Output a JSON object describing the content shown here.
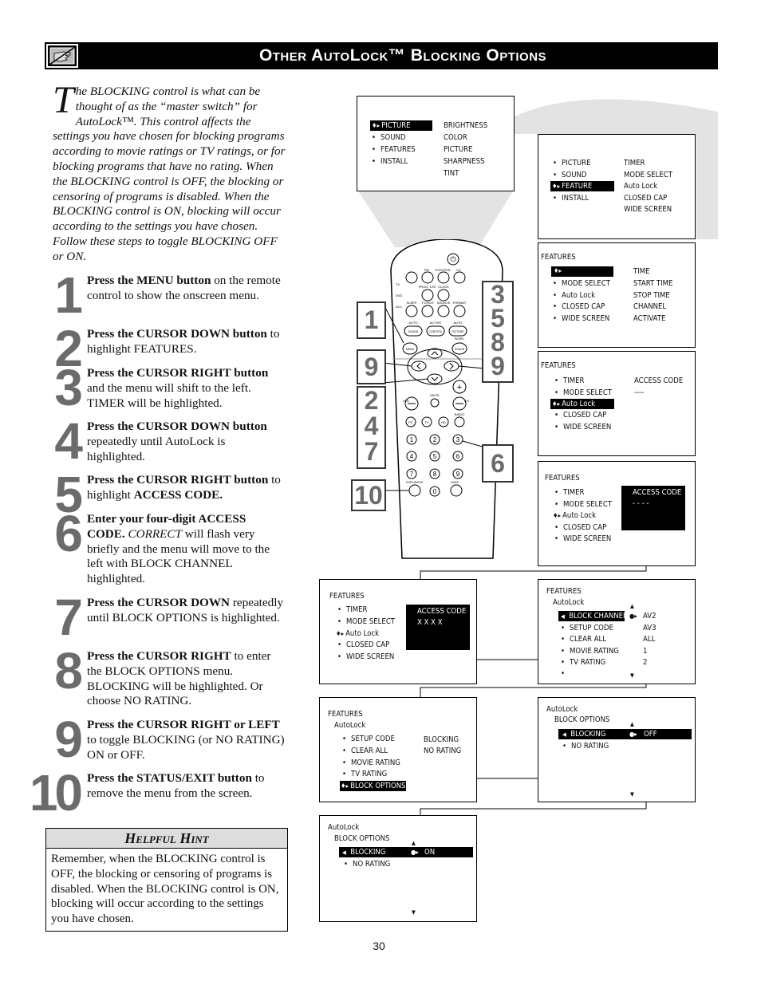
{
  "header": {
    "title": "Other AutoLock™ Blocking Options",
    "icon": "pointing-hand-icon"
  },
  "intro": {
    "dropcap": "T",
    "text": "he BLOCKING control is what can be thought of as the “master switch” for AutoLock™. This control affects the settings you have chosen for blocking programs according to movie ratings or TV ratings, or for blocking programs that have no rating. When the BLOCKING control is OFF, the blocking or censoring of programs is disabled. When the BLOCKING control is ON, blocking will occur according to the settings you have chosen. Follow these steps to toggle BLOCKING OFF or ON."
  },
  "steps": [
    {
      "num": "1",
      "bold": "Press the MENU button",
      "rest": " on the remote control to show the onscreen menu."
    },
    {
      "num": "2",
      "bold": "Press the CURSOR DOWN button",
      "rest": " to highlight FEATURES."
    },
    {
      "num": "3",
      "bold": "Press the CURSOR RIGHT button",
      "rest": " and the menu will shift to the left. TIMER will be highlighted."
    },
    {
      "num": "4",
      "bold": "Press the CURSOR DOWN button",
      "rest": " repeatedly until AutoLock is highlighted."
    },
    {
      "num": "5",
      "bold": "Press the CURSOR RIGHT button",
      "rest": " to highlight ",
      "bold2": "ACCESS CODE."
    },
    {
      "num": "6",
      "bold": "Enter your four-digit ACCESS CODE.",
      "italic": " CORRECT",
      "rest": " will flash very briefly and the menu will move to the left with BLOCK CHANNEL highlighted."
    },
    {
      "num": "7",
      "bold": "Press the CURSOR DOWN",
      "rest": " repeatedly until BLOCK OPTIONS is highlighted."
    },
    {
      "num": "8",
      "bold": "Press the CURSOR RIGHT",
      "rest": " to enter the BLOCK OPTIONS menu. BLOCKING will be highlighted. Or choose NO RATING."
    },
    {
      "num": "9",
      "bold": "Press the CURSOR RIGHT or LEFT",
      "rest": " to toggle BLOCKING (or NO RATING) ON or OFF."
    },
    {
      "num": "10",
      "bold": "Press the STATUS/EXIT button",
      "rest": " to remove the menu from the screen."
    }
  ],
  "hint": {
    "title": "Helpful Hint",
    "body": "Remember, when the BLOCKING control is OFF, the blocking or censoring of programs is disabled. When the BLOCKING control is ON, blocking will occur according to the settings you have chosen."
  },
  "page_number": "30",
  "remote": {
    "labels": {
      "pip": "PIP",
      "position": "POSITION",
      "cc": "CC",
      "tv": "TV",
      "dvd": "DVD",
      "acc": "ACC",
      "prog_list": "PROG. LIST",
      "clock": "CLOCK",
      "sleep": "SLEEP",
      "tv_rch": "TV/RCH",
      "source": "SOURCE",
      "format": "FORMAT",
      "auto1": "AUTO",
      "active": "ACTIVE",
      "auto2": "AUTO",
      "sound": "SOUND",
      "control": "CONTROL",
      "picture": "PICTURE",
      "menu": "MENU",
      "surr": "SURR.",
      "surr_sound": "SOUND",
      "vol": "VOL",
      "mute": "MUTE",
      "ch": "CH",
      "pc": "PC",
      "tvbtn": "TV",
      "hd": "HD",
      "radio": "RADIO",
      "status_exit": "STATUS/EXIT",
      "surf": "SURF",
      "digits": [
        "1",
        "2",
        "3",
        "4",
        "5",
        "6",
        "7",
        "8",
        "9",
        "0"
      ]
    },
    "callouts": {
      "c1": "1",
      "c9": "9",
      "c247": [
        "2",
        "4",
        "7"
      ],
      "c10": "10",
      "c3589": [
        "3",
        "5",
        "8",
        "9"
      ],
      "c6": "6"
    }
  },
  "screens": {
    "s1": {
      "left": [
        {
          "label": "PICTURE",
          "selected": true
        },
        {
          "label": "SOUND"
        },
        {
          "label": "FEATURES"
        },
        {
          "label": "INSTALL"
        }
      ],
      "right": [
        "BRIGHTNESS",
        "COLOR",
        "PICTURE",
        "SHARPNESS",
        "TINT"
      ]
    },
    "s2": {
      "left": [
        {
          "label": "PICTURE"
        },
        {
          "label": "SOUND"
        },
        {
          "label": "FEATURE",
          "selected": true
        },
        {
          "label": "INSTALL"
        }
      ],
      "right": [
        "TIMER",
        "MODE SELECT",
        "Auto Lock",
        "CLOSED CAP",
        "WIDE SCREEN"
      ]
    },
    "s3": {
      "title": "FEATURES",
      "left": [
        {
          "label": "",
          "selected": true
        },
        {
          "label": "MODE SELECT"
        },
        {
          "label": "Auto Lock"
        },
        {
          "label": "CLOSED CAP"
        },
        {
          "label": "WIDE SCREEN"
        }
      ],
      "right": [
        "TIME",
        "START TIME",
        "STOP TIME",
        "CHANNEL",
        "ACTIVATE"
      ]
    },
    "s4": {
      "title": "FEATURES",
      "left": [
        {
          "label": "TIMER"
        },
        {
          "label": "MODE SELECT"
        },
        {
          "label": "Auto Lock",
          "selected": true
        },
        {
          "label": "CLOSED CAP"
        },
        {
          "label": "WIDE SCREEN"
        }
      ],
      "right": [
        "ACCESS CODE",
        "----"
      ]
    },
    "s5": {
      "title": "FEATURES",
      "left": [
        {
          "label": "TIMER"
        },
        {
          "label": "MODE SELECT"
        },
        {
          "label": "Auto Lock",
          "selected": true
        },
        {
          "label": "CLOSED CAP"
        },
        {
          "label": "WIDE SCREEN"
        }
      ],
      "right": [
        "ACCESS CODE",
        "- - - -"
      ]
    },
    "s6": {
      "title": "FEATURES",
      "left": [
        {
          "label": "TIMER"
        },
        {
          "label": "MODE SELECT"
        },
        {
          "label": "Auto Lock",
          "selected": true
        },
        {
          "label": "CLOSED CAP"
        },
        {
          "label": "WIDE SCREEN"
        }
      ],
      "right": [
        "ACCESS CODE",
        "X X X X"
      ]
    },
    "s7": {
      "title": "FEATURES",
      "subtitle": "AutoLock",
      "left": [
        {
          "label": "BLOCK CHANNEL",
          "selected": true
        },
        {
          "label": "SETUP CODE"
        },
        {
          "label": "CLEAR ALL"
        },
        {
          "label": "MOVIE RATING"
        },
        {
          "label": "TV RATING"
        },
        {
          "label": ""
        }
      ],
      "right": [
        "AV2",
        "AV3",
        "ALL",
        "1",
        "2"
      ]
    },
    "s8": {
      "title": "FEATURES",
      "subtitle": "AutoLock",
      "left": [
        {
          "label": "SETUP CODE"
        },
        {
          "label": "CLEAR ALL"
        },
        {
          "label": "MOVIE RATING"
        },
        {
          "label": "TV RATING"
        },
        {
          "label": "BLOCK OPTIONS",
          "selected": true
        }
      ],
      "right": [
        "BLOCKING",
        "NO RATING"
      ]
    },
    "s9": {
      "title": "AutoLock",
      "subtitle": "BLOCK OPTIONS",
      "left": [
        {
          "label": "BLOCKING",
          "selected": true
        },
        {
          "label": "NO RATING"
        }
      ],
      "value": "OFF"
    },
    "s10": {
      "title": "AutoLock",
      "subtitle": "BLOCK OPTIONS",
      "left": [
        {
          "label": "BLOCKING",
          "selected": true
        },
        {
          "label": "NO RATING"
        }
      ],
      "value": "ON"
    }
  }
}
